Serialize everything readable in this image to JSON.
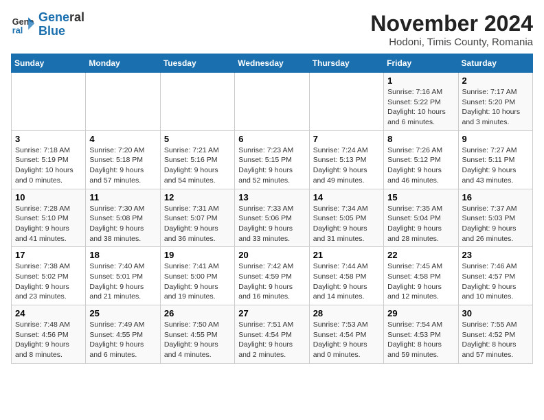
{
  "header": {
    "logo_general": "General",
    "logo_blue": "Blue",
    "title": "November 2024",
    "subtitle": "Hodoni, Timis County, Romania"
  },
  "weekdays": [
    "Sunday",
    "Monday",
    "Tuesday",
    "Wednesday",
    "Thursday",
    "Friday",
    "Saturday"
  ],
  "weeks": [
    [
      {
        "day": "",
        "detail": ""
      },
      {
        "day": "",
        "detail": ""
      },
      {
        "day": "",
        "detail": ""
      },
      {
        "day": "",
        "detail": ""
      },
      {
        "day": "",
        "detail": ""
      },
      {
        "day": "1",
        "detail": "Sunrise: 7:16 AM\nSunset: 5:22 PM\nDaylight: 10 hours\nand 6 minutes."
      },
      {
        "day": "2",
        "detail": "Sunrise: 7:17 AM\nSunset: 5:20 PM\nDaylight: 10 hours\nand 3 minutes."
      }
    ],
    [
      {
        "day": "3",
        "detail": "Sunrise: 7:18 AM\nSunset: 5:19 PM\nDaylight: 10 hours\nand 0 minutes."
      },
      {
        "day": "4",
        "detail": "Sunrise: 7:20 AM\nSunset: 5:18 PM\nDaylight: 9 hours\nand 57 minutes."
      },
      {
        "day": "5",
        "detail": "Sunrise: 7:21 AM\nSunset: 5:16 PM\nDaylight: 9 hours\nand 54 minutes."
      },
      {
        "day": "6",
        "detail": "Sunrise: 7:23 AM\nSunset: 5:15 PM\nDaylight: 9 hours\nand 52 minutes."
      },
      {
        "day": "7",
        "detail": "Sunrise: 7:24 AM\nSunset: 5:13 PM\nDaylight: 9 hours\nand 49 minutes."
      },
      {
        "day": "8",
        "detail": "Sunrise: 7:26 AM\nSunset: 5:12 PM\nDaylight: 9 hours\nand 46 minutes."
      },
      {
        "day": "9",
        "detail": "Sunrise: 7:27 AM\nSunset: 5:11 PM\nDaylight: 9 hours\nand 43 minutes."
      }
    ],
    [
      {
        "day": "10",
        "detail": "Sunrise: 7:28 AM\nSunset: 5:10 PM\nDaylight: 9 hours\nand 41 minutes."
      },
      {
        "day": "11",
        "detail": "Sunrise: 7:30 AM\nSunset: 5:08 PM\nDaylight: 9 hours\nand 38 minutes."
      },
      {
        "day": "12",
        "detail": "Sunrise: 7:31 AM\nSunset: 5:07 PM\nDaylight: 9 hours\nand 36 minutes."
      },
      {
        "day": "13",
        "detail": "Sunrise: 7:33 AM\nSunset: 5:06 PM\nDaylight: 9 hours\nand 33 minutes."
      },
      {
        "day": "14",
        "detail": "Sunrise: 7:34 AM\nSunset: 5:05 PM\nDaylight: 9 hours\nand 31 minutes."
      },
      {
        "day": "15",
        "detail": "Sunrise: 7:35 AM\nSunset: 5:04 PM\nDaylight: 9 hours\nand 28 minutes."
      },
      {
        "day": "16",
        "detail": "Sunrise: 7:37 AM\nSunset: 5:03 PM\nDaylight: 9 hours\nand 26 minutes."
      }
    ],
    [
      {
        "day": "17",
        "detail": "Sunrise: 7:38 AM\nSunset: 5:02 PM\nDaylight: 9 hours\nand 23 minutes."
      },
      {
        "day": "18",
        "detail": "Sunrise: 7:40 AM\nSunset: 5:01 PM\nDaylight: 9 hours\nand 21 minutes."
      },
      {
        "day": "19",
        "detail": "Sunrise: 7:41 AM\nSunset: 5:00 PM\nDaylight: 9 hours\nand 19 minutes."
      },
      {
        "day": "20",
        "detail": "Sunrise: 7:42 AM\nSunset: 4:59 PM\nDaylight: 9 hours\nand 16 minutes."
      },
      {
        "day": "21",
        "detail": "Sunrise: 7:44 AM\nSunset: 4:58 PM\nDaylight: 9 hours\nand 14 minutes."
      },
      {
        "day": "22",
        "detail": "Sunrise: 7:45 AM\nSunset: 4:58 PM\nDaylight: 9 hours\nand 12 minutes."
      },
      {
        "day": "23",
        "detail": "Sunrise: 7:46 AM\nSunset: 4:57 PM\nDaylight: 9 hours\nand 10 minutes."
      }
    ],
    [
      {
        "day": "24",
        "detail": "Sunrise: 7:48 AM\nSunset: 4:56 PM\nDaylight: 9 hours\nand 8 minutes."
      },
      {
        "day": "25",
        "detail": "Sunrise: 7:49 AM\nSunset: 4:55 PM\nDaylight: 9 hours\nand 6 minutes."
      },
      {
        "day": "26",
        "detail": "Sunrise: 7:50 AM\nSunset: 4:55 PM\nDaylight: 9 hours\nand 4 minutes."
      },
      {
        "day": "27",
        "detail": "Sunrise: 7:51 AM\nSunset: 4:54 PM\nDaylight: 9 hours\nand 2 minutes."
      },
      {
        "day": "28",
        "detail": "Sunrise: 7:53 AM\nSunset: 4:54 PM\nDaylight: 9 hours\nand 0 minutes."
      },
      {
        "day": "29",
        "detail": "Sunrise: 7:54 AM\nSunset: 4:53 PM\nDaylight: 8 hours\nand 59 minutes."
      },
      {
        "day": "30",
        "detail": "Sunrise: 7:55 AM\nSunset: 4:52 PM\nDaylight: 8 hours\nand 57 minutes."
      }
    ]
  ]
}
